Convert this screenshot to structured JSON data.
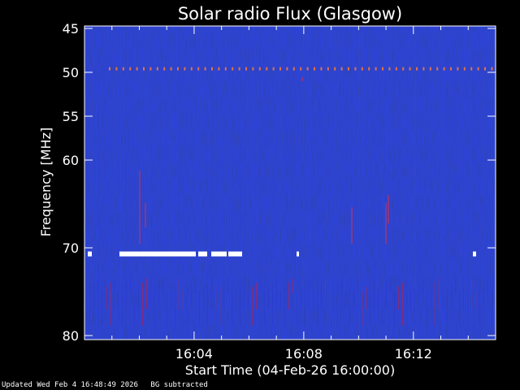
{
  "chart_data": {
    "type": "heatmap",
    "title": "Solar radio Flux (Glasgow)",
    "ylabel": "Frequency [MHz]",
    "xlabel": "Start Time (04-Feb-26 16:00:00)",
    "y_axis": {
      "ylim": [
        45,
        80
      ],
      "ticks": [
        45,
        50,
        55,
        60,
        70,
        80
      ],
      "tick_labels": [
        "45",
        "50",
        "55",
        "60",
        "70",
        "80"
      ],
      "direction": "top-to-bottom"
    },
    "x_axis": {
      "start": "16:00",
      "xlim_minutes": [
        0,
        15
      ],
      "ticks_minutes": [
        4,
        8,
        12
      ],
      "tick_labels": [
        "16:04",
        "16:08",
        "16:12"
      ]
    },
    "colormap": [
      "#0a0a90",
      "#1a2fd8",
      "#c02040",
      "#ffffff"
    ],
    "grid": false,
    "legend": "none"
  },
  "footer": {
    "updated": "Updated Wed Feb  4 16:48:49 2026",
    "note": "BG subtracted"
  }
}
